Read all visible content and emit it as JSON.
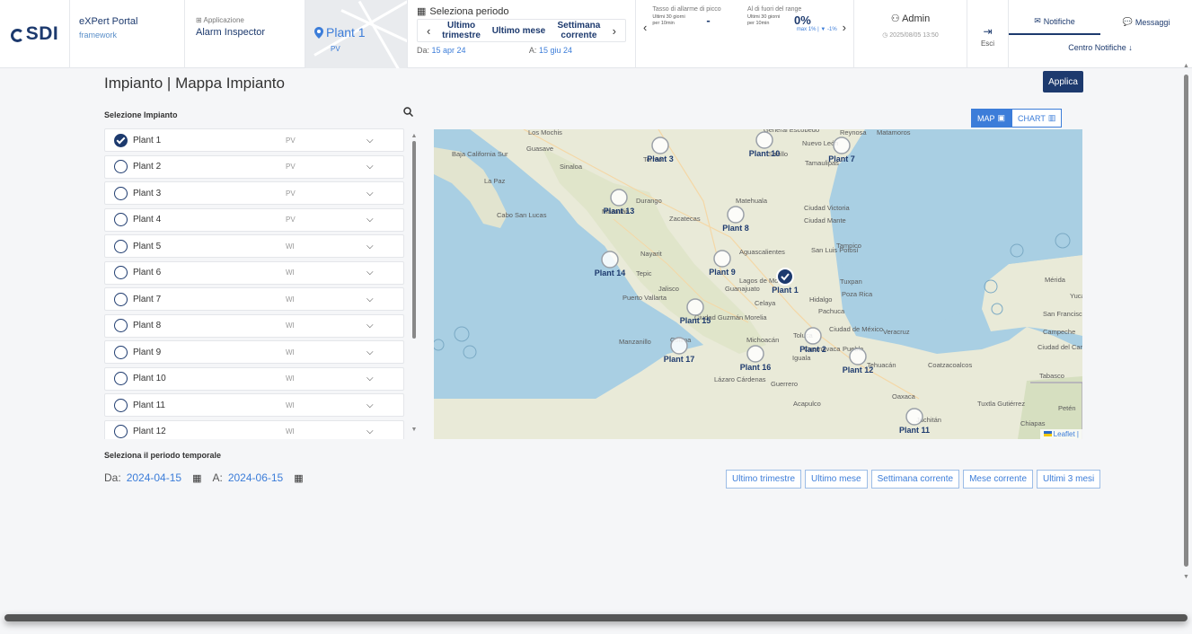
{
  "header": {
    "logo": "SDI",
    "portal_title": "eXPert Portal",
    "portal_sub": "framework",
    "app_label": "Applicazione",
    "app_name": "Alarm Inspector",
    "plant_name": "Plant 1",
    "plant_type": "PV",
    "period": {
      "label": "Seleziona periodo",
      "options": [
        "Ultimo trimestre",
        "Ultimo mese",
        "Settimana corrente"
      ],
      "da_label": "Da:",
      "da_value": "15 apr 24",
      "a_label": "A:",
      "a_value": "15 giu 24"
    },
    "alarms": {
      "peak_label": "Tasso di allarme di picco",
      "peak_sub1": "Ultimi 30 giorni",
      "peak_sub2": "per 10min",
      "peak_value": "-",
      "range_label": "Al di fuori del range",
      "range_sub1": "Ultimi 30 giorni",
      "range_sub2": "per 10min",
      "range_value": "0%",
      "range_max": "max 1% | ▼ -1%"
    },
    "user": "Admin",
    "timestamp": "2025/08/05 13:50",
    "logout": "Esci",
    "notif_tab": "Notifiche",
    "msg_tab": "Messaggi",
    "centro": "Centro Notifiche"
  },
  "page": {
    "title": "Impianto | Mappa Impianto",
    "apply": "Applica",
    "selection_title": "Selezione Impianto",
    "period_title": "Seleziona il periodo temporale",
    "da_label": "Da:",
    "da_value": "2024-04-15",
    "a_label": "A:",
    "a_value": "2024-06-15",
    "view_map": "MAP",
    "view_chart": "CHART"
  },
  "plants": [
    {
      "name": "Plant 1",
      "type": "PV",
      "selected": true
    },
    {
      "name": "Plant 2",
      "type": "PV",
      "selected": false
    },
    {
      "name": "Plant 3",
      "type": "PV",
      "selected": false
    },
    {
      "name": "Plant 4",
      "type": "PV",
      "selected": false
    },
    {
      "name": "Plant 5",
      "type": "WI",
      "selected": false
    },
    {
      "name": "Plant 6",
      "type": "WI",
      "selected": false
    },
    {
      "name": "Plant 7",
      "type": "WI",
      "selected": false
    },
    {
      "name": "Plant 8",
      "type": "WI",
      "selected": false
    },
    {
      "name": "Plant 9",
      "type": "WI",
      "selected": false
    },
    {
      "name": "Plant 10",
      "type": "WI",
      "selected": false
    },
    {
      "name": "Plant 11",
      "type": "WI",
      "selected": false
    },
    {
      "name": "Plant 12",
      "type": "WI",
      "selected": false
    }
  ],
  "quick_periods": [
    "Ultimo trimestre",
    "Ultimo mese",
    "Settimana corrente",
    "Mese corrente",
    "Ultimi 3 mesi"
  ],
  "map": {
    "attribution": "Leaflet |",
    "markers": [
      "Plant 3",
      "Plant 10",
      "Plant 7",
      "Plant 13",
      "Plant 8",
      "Plant 14",
      "Plant 9",
      "Plant 1",
      "Plant 15",
      "Plant 2",
      "Plant 17",
      "Plant 16",
      "Plant 12",
      "Plant 11"
    ],
    "cities": [
      "Los Mochis",
      "Guasave",
      "Sinaloa",
      "Durango",
      "Torreón",
      "General Escobedo",
      "Reynosa",
      "Matamoros",
      "Nuevo León",
      "Tamaulipas",
      "Saltillo",
      "La Paz",
      "Cabo San Lucas",
      "Mazatlán",
      "Zacatecas",
      "Matehuala",
      "Ciudad Victoria",
      "Ciudad Mante",
      "Tampico",
      "San Luis Potosí",
      "Aguascalientes",
      "Nayarit",
      "Tepic",
      "Lagos de Moreno",
      "Jalisco",
      "Guanajuato",
      "Tuxpan",
      "Poza Rica",
      "Puerto Vallarta",
      "Celaya",
      "Hidalgo",
      "Ciudad Guzmán",
      "Morelia",
      "Pachuca",
      "Ciudad de México",
      "Veracruz",
      "Toluca",
      "Michoacán",
      "Manzanillo",
      "Colima",
      "Cuernavaca",
      "Puebla",
      "Iguala",
      "Tehuacán",
      "Coatzacoalcos",
      "Lázaro Cárdenas",
      "Guerrero",
      "Acapulco",
      "Oaxaca",
      "Tuxtla Gutiérrez",
      "Juchitán",
      "Chiapas",
      "Mérida",
      "San Francisco de Campeche",
      "Campeche",
      "Ciudad del Carmen",
      "Tabasco",
      "Yucatán",
      "Petén",
      "Baja California Sur"
    ]
  },
  "colors": {
    "primary": "#1d3a6e",
    "accent": "#3c7dd9"
  }
}
